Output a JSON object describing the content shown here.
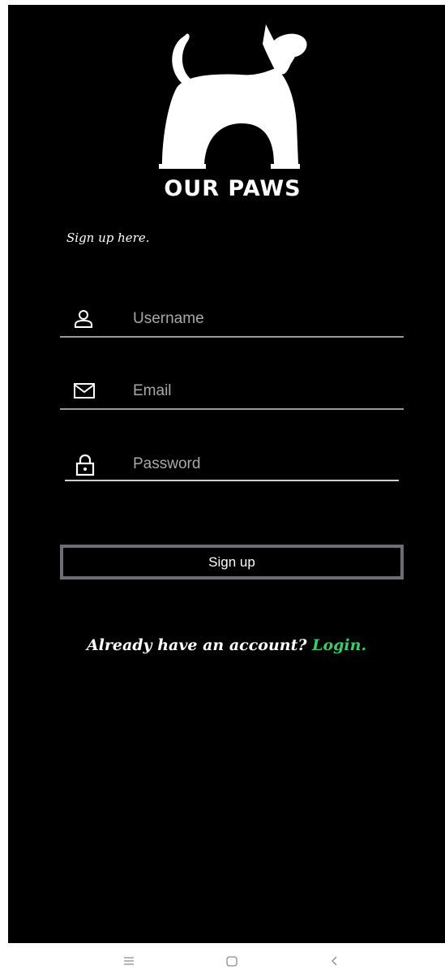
{
  "app": {
    "brand": "OUR PAWS",
    "brand_logo": "cat-silhouette-icon"
  },
  "form": {
    "subtitle": "Sign up here.",
    "username": {
      "placeholder": "Username",
      "value": "",
      "icon": "user-icon"
    },
    "email": {
      "placeholder": "Email",
      "value": "",
      "icon": "mail-icon"
    },
    "password": {
      "placeholder": "Password",
      "value": "",
      "icon": "lock-icon"
    },
    "submit_label": "Sign up"
  },
  "footer": {
    "prompt": "Already have an account?",
    "login_label": "Login."
  },
  "navbar": {
    "menu_icon": "menu-icon",
    "home_icon": "home-square-icon",
    "back_icon": "back-chevron-icon"
  },
  "colors": {
    "background": "#000000",
    "text": "#ffffff",
    "accent": "#3ec96a",
    "button_border": "#6e6e76"
  }
}
